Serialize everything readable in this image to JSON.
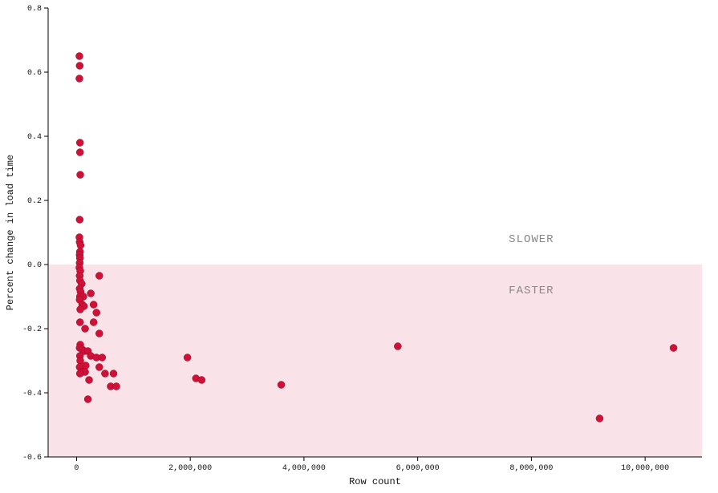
{
  "chart_data": {
    "type": "scatter",
    "title": "",
    "xlabel": "Row count",
    "ylabel": "Percent change in load time",
    "xlim": [
      -500000,
      11000000
    ],
    "ylim": [
      -0.6,
      0.8
    ],
    "xticks": [
      0,
      2000000,
      4000000,
      6000000,
      8000000,
      10000000
    ],
    "xtick_labels": [
      "0",
      "2,000,000",
      "4,000,000",
      "6,000,000",
      "8,000,000",
      "10,000,000"
    ],
    "yticks": [
      -0.6,
      -0.4,
      -0.2,
      0.0,
      0.2,
      0.4,
      0.6,
      0.8
    ],
    "ytick_labels": [
      "-0.6",
      "-0.4",
      "-0.2",
      "0.0",
      "0.2",
      "0.4",
      "0.6",
      "0.8"
    ],
    "annotations": [
      {
        "text": "SLOWER",
        "x": 8000000,
        "y": 0.08
      },
      {
        "text": "FASTER",
        "x": 8000000,
        "y": -0.08
      }
    ],
    "shaded_region": {
      "y0": -0.6,
      "y1": 0.0
    },
    "points": [
      {
        "x": 50000,
        "y": 0.65
      },
      {
        "x": 55000,
        "y": 0.62
      },
      {
        "x": 50000,
        "y": 0.58
      },
      {
        "x": 60000,
        "y": 0.38
      },
      {
        "x": 60000,
        "y": 0.35
      },
      {
        "x": 65000,
        "y": 0.28
      },
      {
        "x": 55000,
        "y": 0.14
      },
      {
        "x": 50000,
        "y": 0.085
      },
      {
        "x": 55000,
        "y": 0.07
      },
      {
        "x": 70000,
        "y": 0.06
      },
      {
        "x": 60000,
        "y": 0.04
      },
      {
        "x": 55000,
        "y": 0.03
      },
      {
        "x": 60000,
        "y": 0.02
      },
      {
        "x": 55000,
        "y": 0.005
      },
      {
        "x": 50000,
        "y": -0.01
      },
      {
        "x": 65000,
        "y": -0.02
      },
      {
        "x": 55000,
        "y": -0.035
      },
      {
        "x": 400000,
        "y": -0.035
      },
      {
        "x": 60000,
        "y": -0.05
      },
      {
        "x": 90000,
        "y": -0.06
      },
      {
        "x": 55000,
        "y": -0.075
      },
      {
        "x": 70000,
        "y": -0.085
      },
      {
        "x": 250000,
        "y": -0.09
      },
      {
        "x": 60000,
        "y": -0.1
      },
      {
        "x": 120000,
        "y": -0.1
      },
      {
        "x": 55000,
        "y": -0.11
      },
      {
        "x": 100000,
        "y": -0.125
      },
      {
        "x": 130000,
        "y": -0.13
      },
      {
        "x": 300000,
        "y": -0.125
      },
      {
        "x": 65000,
        "y": -0.14
      },
      {
        "x": 350000,
        "y": -0.15
      },
      {
        "x": 60000,
        "y": -0.18
      },
      {
        "x": 300000,
        "y": -0.18
      },
      {
        "x": 150000,
        "y": -0.2
      },
      {
        "x": 400000,
        "y": -0.215
      },
      {
        "x": 65000,
        "y": -0.25
      },
      {
        "x": 55000,
        "y": -0.26
      },
      {
        "x": 100000,
        "y": -0.265
      },
      {
        "x": 140000,
        "y": -0.27
      },
      {
        "x": 200000,
        "y": -0.27
      },
      {
        "x": 60000,
        "y": -0.285
      },
      {
        "x": 250000,
        "y": -0.285
      },
      {
        "x": 350000,
        "y": -0.29
      },
      {
        "x": 450000,
        "y": -0.29
      },
      {
        "x": 65000,
        "y": -0.3
      },
      {
        "x": 160000,
        "y": -0.315
      },
      {
        "x": 55000,
        "y": -0.32
      },
      {
        "x": 100000,
        "y": -0.335
      },
      {
        "x": 150000,
        "y": -0.335
      },
      {
        "x": 60000,
        "y": -0.34
      },
      {
        "x": 400000,
        "y": -0.32
      },
      {
        "x": 500000,
        "y": -0.34
      },
      {
        "x": 650000,
        "y": -0.34
      },
      {
        "x": 220000,
        "y": -0.36
      },
      {
        "x": 600000,
        "y": -0.38
      },
      {
        "x": 700000,
        "y": -0.38
      },
      {
        "x": 200000,
        "y": -0.42
      },
      {
        "x": 1950000,
        "y": -0.29
      },
      {
        "x": 2100000,
        "y": -0.355
      },
      {
        "x": 2200000,
        "y": -0.36
      },
      {
        "x": 3600000,
        "y": -0.375
      },
      {
        "x": 5650000,
        "y": -0.255
      },
      {
        "x": 9200000,
        "y": -0.48
      },
      {
        "x": 10500000,
        "y": -0.26
      }
    ]
  },
  "colors": {
    "point": "#cf1138",
    "shade": "#f9e0e6"
  }
}
